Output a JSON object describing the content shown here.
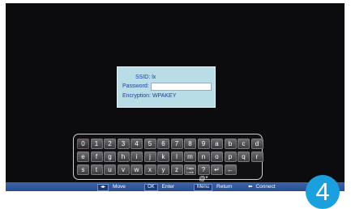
{
  "dialog": {
    "ssid_line": "SSID: lx",
    "password_label": "Password:",
    "password_value": "",
    "encryption_line": "Encryption: WPAKEY"
  },
  "keyboard": {
    "selected": "0",
    "rows": [
      [
        "0",
        "1",
        "2",
        "3",
        "4",
        "5",
        "6",
        "7",
        "8",
        "9",
        "a",
        "b",
        "c",
        "d"
      ],
      [
        "e",
        "f",
        "g",
        "h",
        "i",
        "j",
        "k",
        "l",
        "m",
        "n",
        "o",
        "p",
        "q",
        "r"
      ],
      [
        "s",
        "t",
        "u",
        "v",
        "w",
        "x",
        "y",
        "z",
        "Caps Lock",
        "?@*",
        "↵",
        "←"
      ]
    ]
  },
  "bottom_bar": {
    "move_key": "◂▸",
    "move_label": "Move",
    "enter_key": "OK",
    "enter_label": "Enter",
    "return_key": "Menu",
    "return_label": "Return",
    "connect_key": "⬅",
    "connect_label": "Connect"
  },
  "step_number": "4",
  "colors": {
    "screen": "#0c0c0e",
    "dialog_bg": "#b8dde6",
    "dialog_text": "#1a3ea0",
    "bar": "#2a4e90",
    "badge": "#1aa0dc",
    "selected_key_border": "#e03030"
  }
}
